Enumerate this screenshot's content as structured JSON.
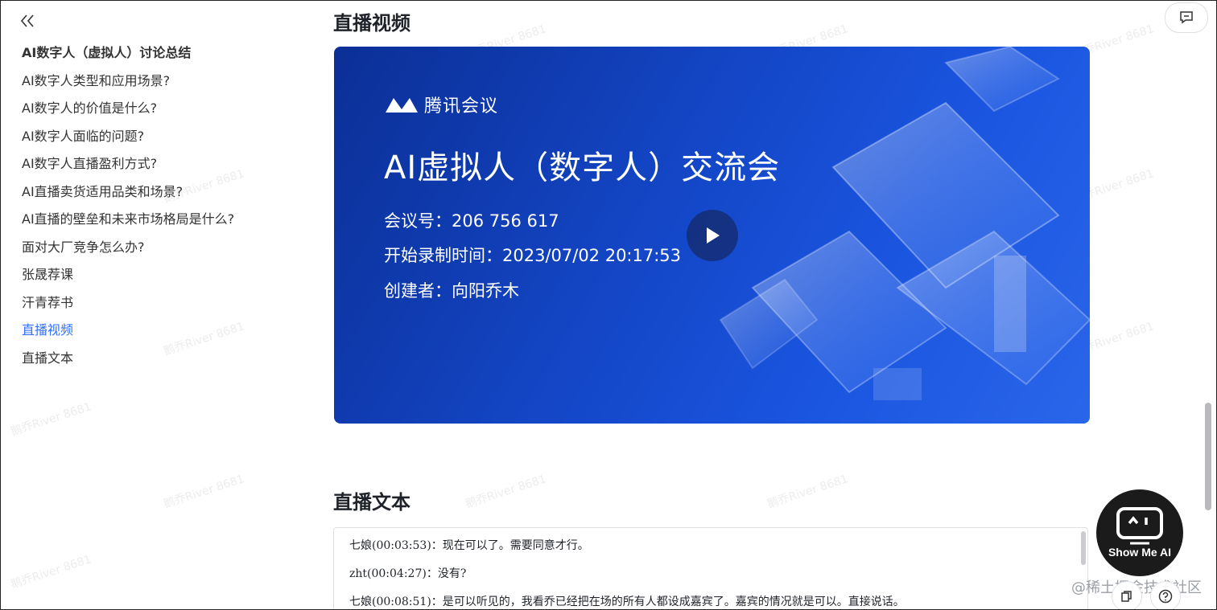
{
  "sidebar": {
    "items": [
      {
        "label": "AI数字人（虚拟人）讨论总结"
      },
      {
        "label": "AI数字人类型和应用场景?"
      },
      {
        "label": "AI数字人的价值是什么?"
      },
      {
        "label": "AI数字人面临的问题?"
      },
      {
        "label": "AI数字人直播盈利方式?"
      },
      {
        "label": "AI直播卖货适用品类和场景?"
      },
      {
        "label": "AI直播的壁垒和未来市场格局是什么?"
      },
      {
        "label": "面对大厂竞争怎么办?"
      },
      {
        "label": "张晟荐课"
      },
      {
        "label": "汗青荐书"
      },
      {
        "label": "直播视频"
      },
      {
        "label": "直播文本"
      }
    ],
    "active_index": 10
  },
  "main": {
    "video_heading": "直播视频",
    "video": {
      "brand": "腾讯会议",
      "title": "AI虚拟人（数字人）交流会",
      "meeting_id": "会议号：206 756 617",
      "record_time": "开始录制时间：2023/07/02 20:17:53",
      "creator": "创建者：向阳乔木"
    },
    "text_heading": "直播文本",
    "transcript": [
      "七娘(00:03:53)：现在可以了。需要同意才行。",
      "zht(00:04:27)：没有?",
      "七娘(00:08:51)：是可以听见的，我看乔已经把在场的所有人都设成嘉宾了。嘉宾的情况就是可以。直接说话。"
    ]
  },
  "assistant": {
    "label": "Show Me AI"
  },
  "watermark": {
    "site": "@稀土掘金技术社区",
    "tile": "鹅乔River 8681"
  },
  "colors": {
    "active": "#3370ff",
    "video_bg": "#1447c8"
  },
  "icons": {
    "collapse": "double-chevron-left-icon",
    "comment": "comment-icon",
    "play": "play-icon",
    "copy": "copy-icon",
    "help": "help-icon"
  }
}
